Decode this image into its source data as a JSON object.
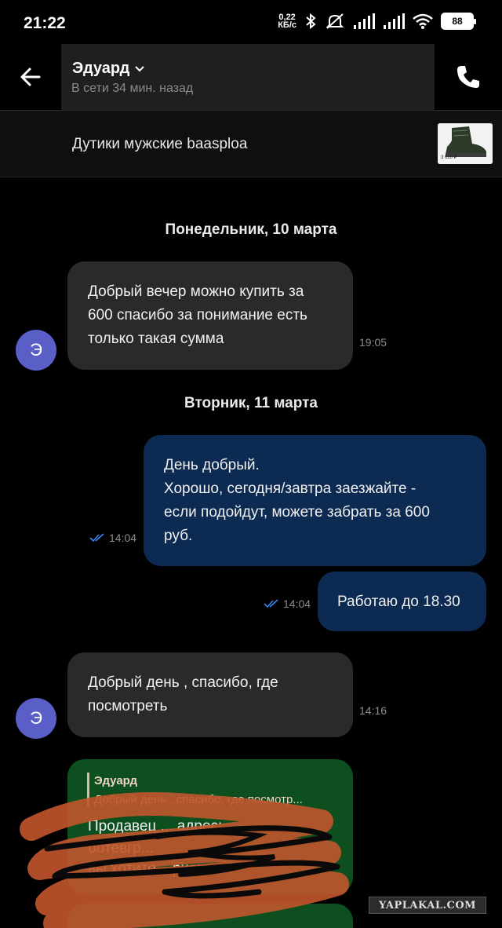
{
  "status_bar": {
    "time": "21:22",
    "speed_value": "0,22",
    "speed_unit": "КБ/с",
    "battery": "88",
    "icons": [
      "bluetooth-icon",
      "mute-icon",
      "signal-icon",
      "signal-icon",
      "wifi-icon",
      "battery-icon"
    ]
  },
  "header": {
    "contact_name": "Эдуард",
    "contact_status": "В сети 34 мин. назад",
    "back_icon": "arrow-left-icon",
    "call_icon": "phone-icon"
  },
  "product": {
    "title": "Дутики мужские baasploa",
    "thumb_text": "3 020 ₽"
  },
  "messages": {
    "date1": "Понедельник, 10 марта",
    "m1": {
      "avatar": "Э",
      "lines": [
        "Добрый вечер можно купить за",
        "600 спасибо за понимание есть",
        "только такая сумма"
      ],
      "time": "19:05"
    },
    "date2": "Вторник, 11 марта",
    "m2": {
      "lines": [
        "День добрый.",
        "Хорошо, сегодня/завтра заезжайте -",
        "если подойдут, можете забрать за 600",
        "руб."
      ],
      "time": "14:04"
    },
    "m3": {
      "lines": [
        "Работаю до 18.30"
      ],
      "time": "14:04"
    },
    "m4": {
      "avatar": "Э",
      "lines": [
        "Добрый день , спасибо, где",
        "посмотреть"
      ],
      "time": "14:16"
    },
    "m5": {
      "quote_name": "Эдуард",
      "quote_text": "Добрый день , спасибо, где посмотр...",
      "lines": [
        "Продавец ... адрес:",
        "ботевгр...",
        "вы хотите ...риехать?"
      ]
    }
  },
  "watermark": "YAPLAKAL.COM",
  "colors": {
    "incoming_bubble": "#2a2a2a",
    "outgoing_bubble": "#0d2a52",
    "avatar": "#5a5ec7",
    "green_bubble": "#0d4f1f"
  }
}
